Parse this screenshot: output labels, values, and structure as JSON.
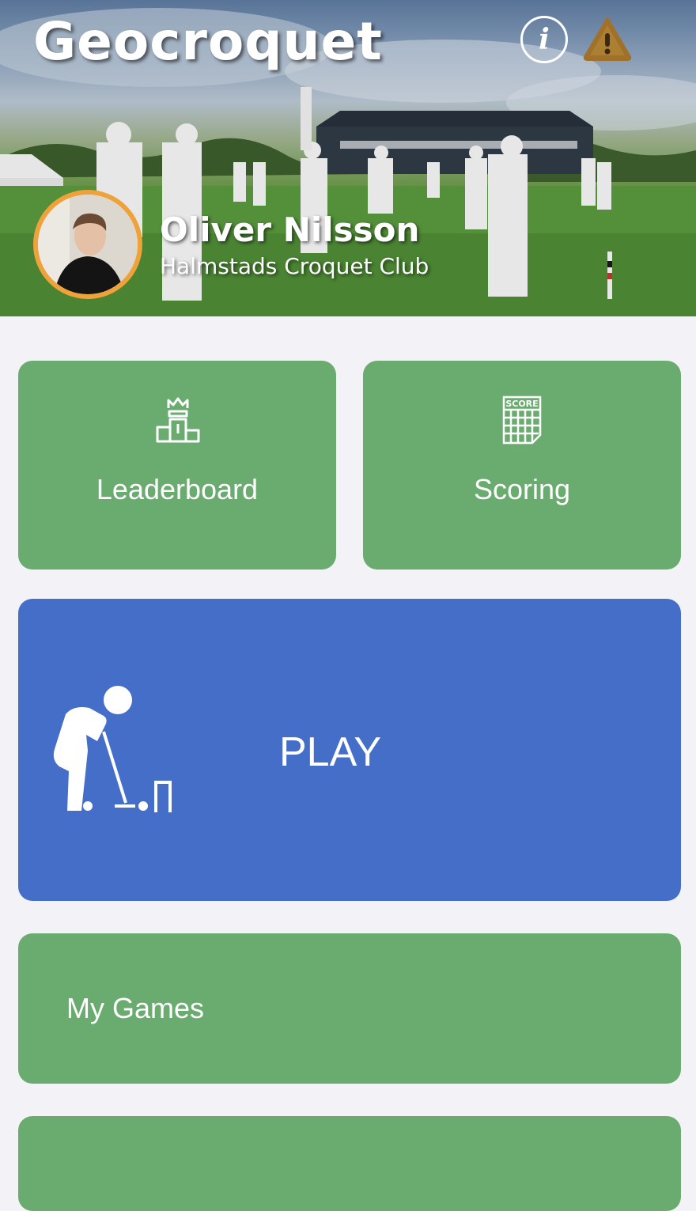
{
  "header": {
    "app_title": "Geocroquet",
    "info_icon": "info-icon",
    "warning_icon": "warning-icon",
    "warning_color": "#a0712a"
  },
  "profile": {
    "name": "Oliver Nilsson",
    "club": "Halmstads Croquet Club",
    "avatar_border_color": "#f0a23a"
  },
  "tiles": {
    "leaderboard": {
      "label": "Leaderboard",
      "icon": "podium-icon"
    },
    "scoring": {
      "label": "Scoring",
      "icon": "scorecard-icon",
      "icon_text": "SCORE"
    },
    "play": {
      "label": "PLAY",
      "icon": "croquet-player-icon"
    },
    "my_games": {
      "label": "My Games"
    }
  },
  "colors": {
    "tile_green": "#6aab6f",
    "tile_blue": "#446ec8",
    "background": "#f2f2f7"
  }
}
